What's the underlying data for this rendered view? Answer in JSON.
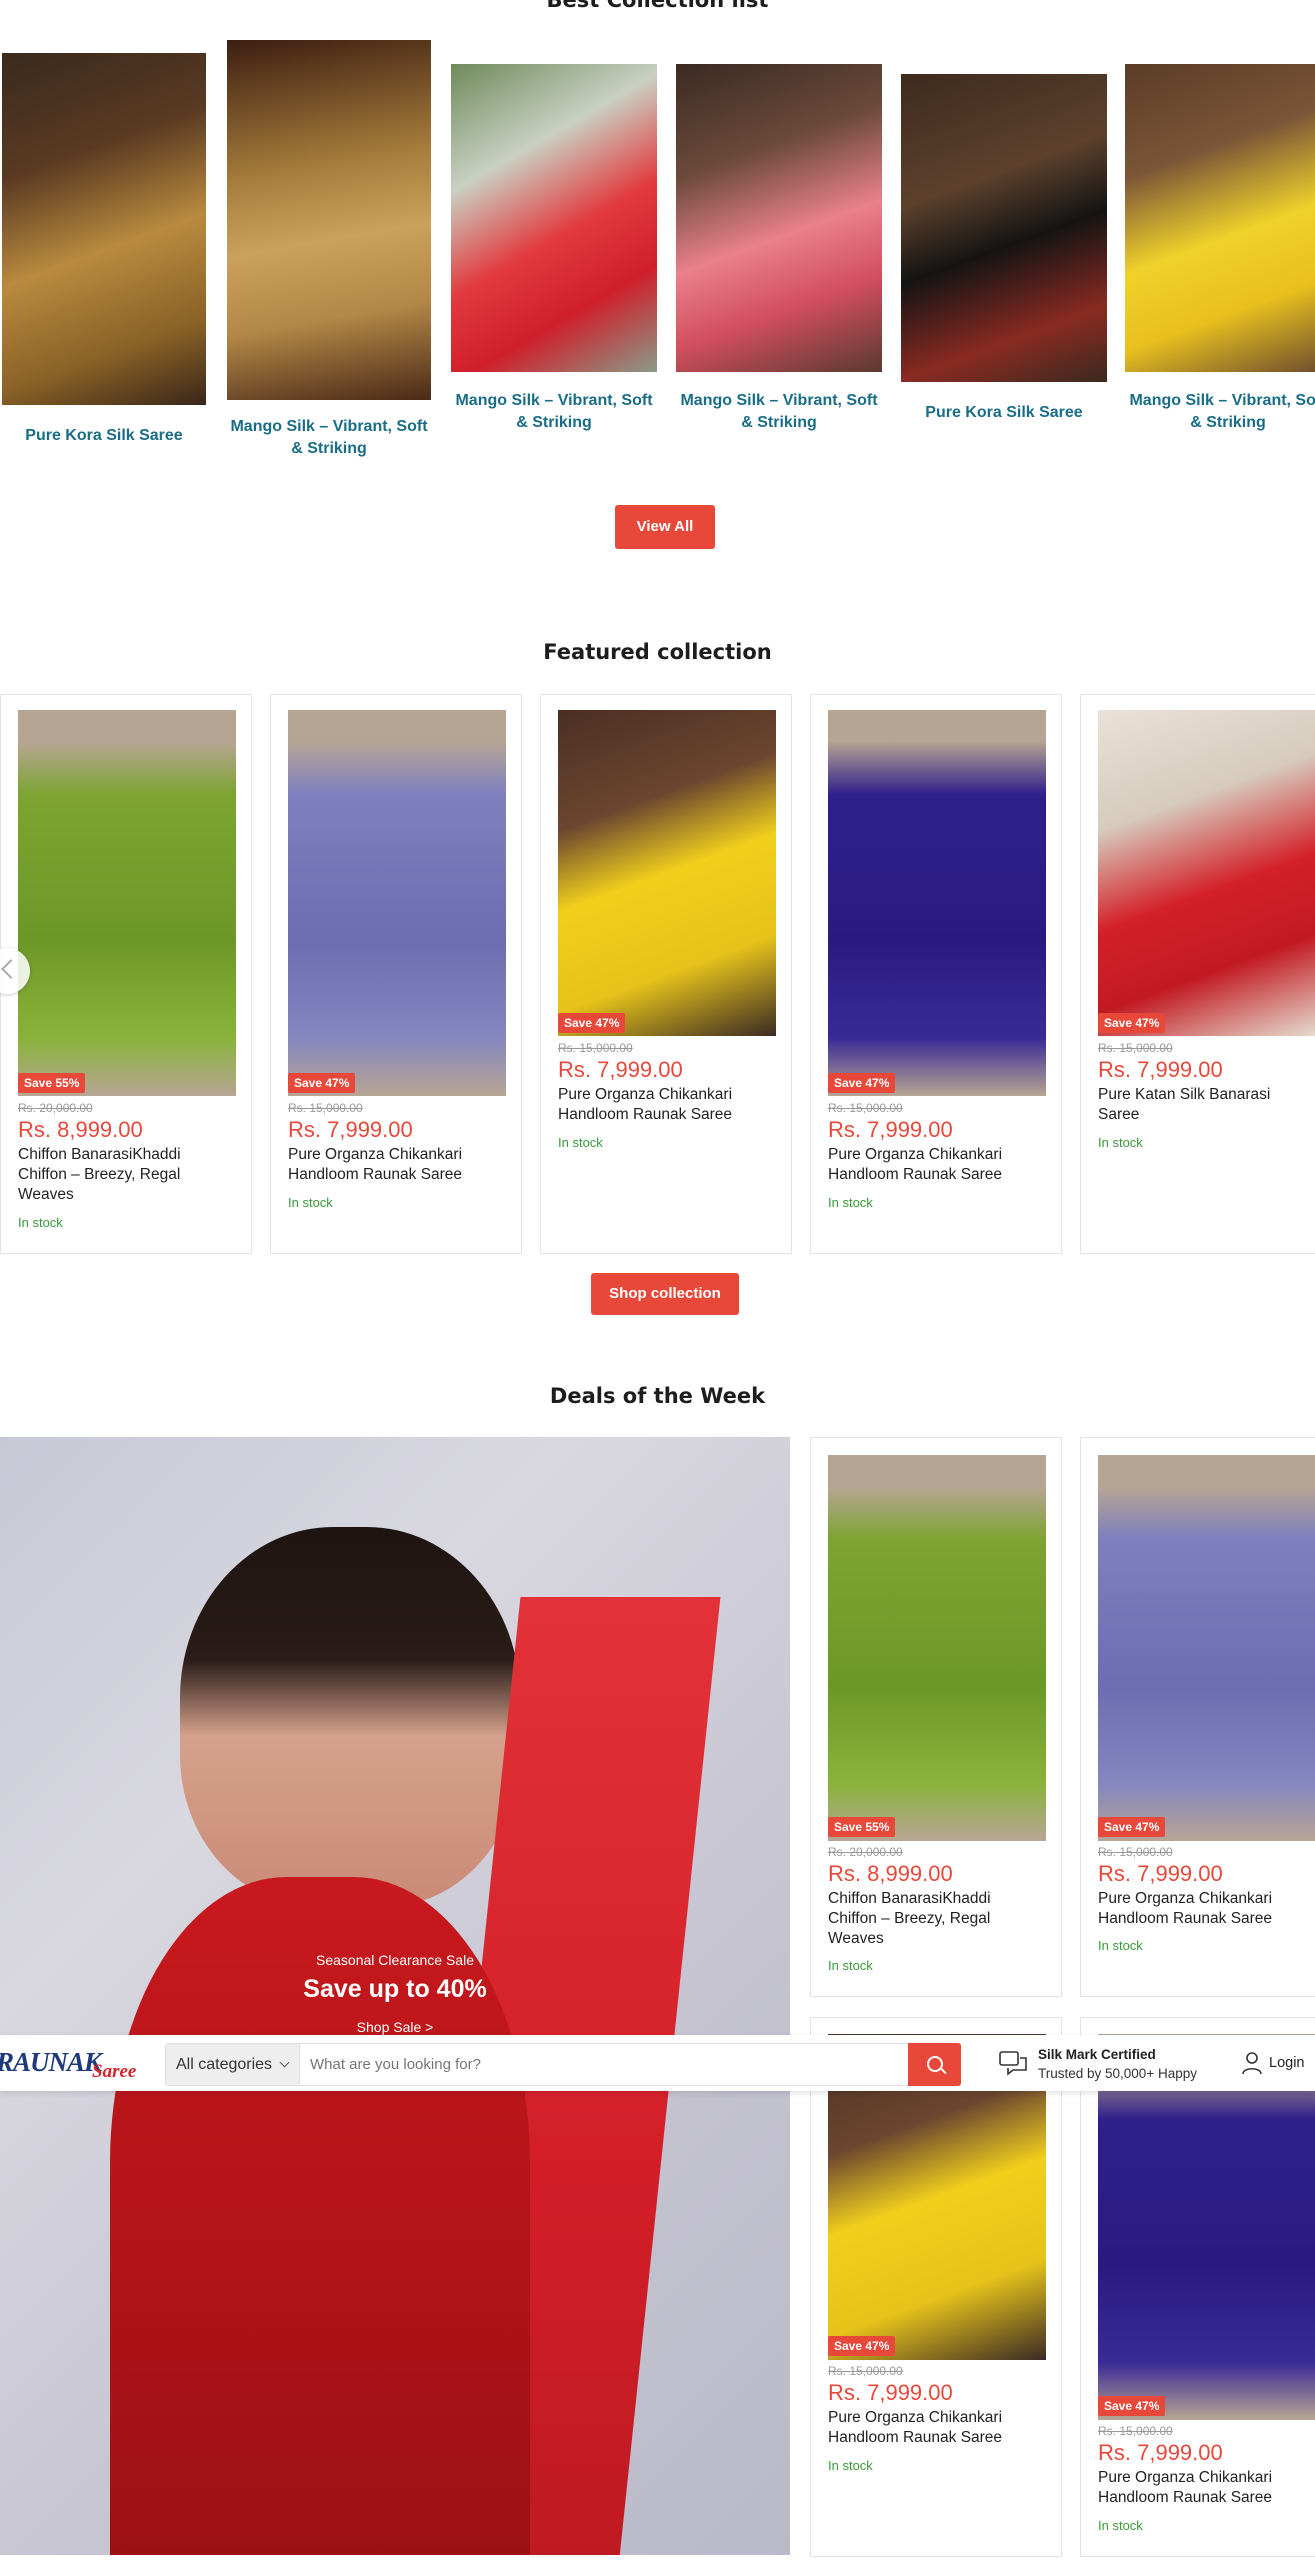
{
  "colors": {
    "accent": "#e8483a",
    "link": "#1a6d86",
    "instock": "#3a9a3a"
  },
  "best_collection": {
    "title": "Best Collection list",
    "items": [
      {
        "label": "Pure Kora Silk Saree"
      },
      {
        "label": "Mango Silk – Vibrant, Soft & Striking"
      },
      {
        "label": "Mango Silk – Vibrant, Soft & Striking"
      },
      {
        "label": "Mango Silk – Vibrant, Soft & Striking"
      },
      {
        "label": "Pure Kora Silk Saree"
      },
      {
        "label": "Mango Silk – Vibrant, Soft & Striking"
      }
    ],
    "view_all": "View All"
  },
  "featured": {
    "title": "Featured collection",
    "products": [
      {
        "badge": "Save 55%",
        "was": "Rs. 20,000.00",
        "price": "Rs. 8,999.00",
        "name": "Chiffon BanarasiKhaddi Chiffon – Breezy, Regal Weaves",
        "stock": "In stock"
      },
      {
        "badge": "Save 47%",
        "was": "Rs. 15,000.00",
        "price": "Rs. 7,999.00",
        "name": "Pure Organza Chikankari Handloom Raunak Saree",
        "stock": "In stock"
      },
      {
        "badge": "Save 47%",
        "was": "Rs. 15,000.00",
        "price": "Rs. 7,999.00",
        "name": "Pure Organza Chikankari Handloom Raunak Saree",
        "stock": "In stock"
      },
      {
        "badge": "Save 47%",
        "was": "Rs. 15,000.00",
        "price": "Rs. 7,999.00",
        "name": "Pure Organza Chikankari Handloom Raunak Saree",
        "stock": "In stock"
      },
      {
        "badge": "Save 47%",
        "was": "Rs. 15,000.00",
        "price": "Rs. 7,999.00",
        "name": "Pure Katan Silk Banarasi Saree",
        "stock": "In stock"
      }
    ],
    "shop_btn": "Shop collection"
  },
  "deals": {
    "title": "Deals of the Week",
    "promo": {
      "eyebrow": "Seasonal Clearance Sale",
      "headline": "Save up to 40%",
      "cta": "Shop Sale >"
    },
    "products": [
      {
        "badge": "Save 55%",
        "was": "Rs. 20,000.00",
        "price": "Rs. 8,999.00",
        "name": "Chiffon BanarasiKhaddi Chiffon – Breezy, Regal Weaves",
        "stock": "In stock"
      },
      {
        "badge": "Save 47%",
        "was": "Rs. 15,000.00",
        "price": "Rs. 7,999.00",
        "name": "Pure Organza Chikankari Handloom Raunak Saree",
        "stock": "In stock"
      },
      {
        "badge": "Save 47%",
        "was": "Rs. 15,000.00",
        "price": "Rs. 7,999.00",
        "name": "Pure Organza Chikankari Handloom Raunak Saree",
        "stock": "In stock"
      },
      {
        "badge": "Save 47%",
        "was": "Rs. 15,000.00",
        "price": "Rs. 7,999.00",
        "name": "Pure Organza Chikankari Handloom Raunak Saree",
        "stock": "In stock"
      }
    ]
  },
  "header": {
    "logo_main": "RAUNAK",
    "logo_sub": "Saree",
    "category": "All categories",
    "search_placeholder": "What are you looking for?",
    "trust_title": "Silk Mark Certified",
    "trust_sub": "Trusted by 50,000+ Happy",
    "login": "Login"
  }
}
